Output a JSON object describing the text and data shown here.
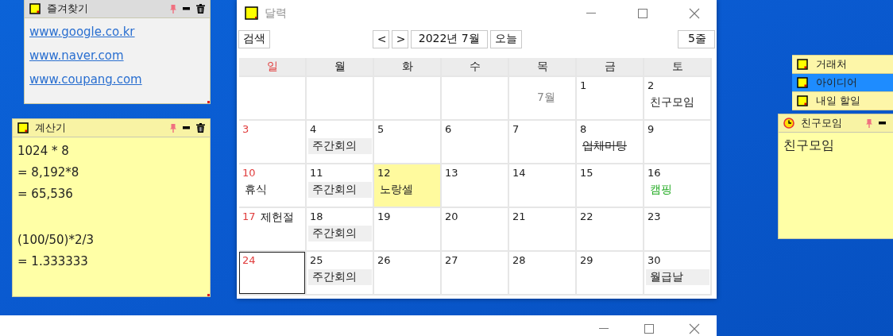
{
  "favorites_note": {
    "title": "즐겨찾기",
    "links": [
      "www.google.co.kr",
      "www.naver.com",
      "www.coupang.com"
    ]
  },
  "calculator_note": {
    "title": "계산기",
    "paragraphs": [
      [
        "1024 * 8",
        "= 8,192*8",
        "= 65,536"
      ],
      [
        "(100/50)*2/3",
        "= 1.333333"
      ]
    ]
  },
  "calendar": {
    "title": "달력",
    "toolbar": {
      "search": "검색",
      "prev": "<",
      "next": ">",
      "month": "2022년 7월",
      "today": "오늘",
      "rows": "5줄"
    },
    "weekdays": [
      {
        "label": "일",
        "kind": "sunday"
      },
      {
        "label": "월",
        "kind": "weekday"
      },
      {
        "label": "화",
        "kind": "weekday"
      },
      {
        "label": "수",
        "kind": "weekday"
      },
      {
        "label": "목",
        "kind": "weekday"
      },
      {
        "label": "금",
        "kind": "weekday"
      },
      {
        "label": "토",
        "kind": "weekday"
      }
    ],
    "weeks": [
      [
        {
          "selected": false,
          "highlighted": false
        },
        {
          "selected": false,
          "highlighted": false
        },
        {
          "selected": false,
          "highlighted": false
        },
        {
          "selected": false,
          "highlighted": false
        },
        {
          "month_label": "7월",
          "selected": false,
          "highlighted": false
        },
        {
          "day": "1",
          "selected": false,
          "highlighted": false
        },
        {
          "day": "2",
          "selected": false,
          "highlighted": false,
          "events": [
            {
              "text": "친구모임",
              "kind": "plain",
              "done": false,
              "color": "#202020"
            }
          ]
        }
      ],
      [
        {
          "day": "3",
          "selected": false,
          "highlighted": false
        },
        {
          "day": "4",
          "selected": false,
          "highlighted": false,
          "events": [
            {
              "text": "주간회의",
              "kind": "boxed",
              "done": false,
              "color": "#202020"
            }
          ]
        },
        {
          "day": "5",
          "selected": false,
          "highlighted": false
        },
        {
          "day": "6",
          "selected": false,
          "highlighted": false
        },
        {
          "day": "7",
          "selected": false,
          "highlighted": false
        },
        {
          "day": "8",
          "selected": false,
          "highlighted": false,
          "events": [
            {
              "text": "업체미팅",
              "kind": "plain",
              "done": true,
              "color": "#202020"
            }
          ]
        },
        {
          "day": "9",
          "selected": false,
          "highlighted": false
        }
      ],
      [
        {
          "day": "10",
          "selected": false,
          "highlighted": false,
          "events": [
            {
              "text": "휴식",
              "kind": "plain",
              "done": false,
              "color": "#202020"
            }
          ]
        },
        {
          "day": "11",
          "selected": false,
          "highlighted": false,
          "events": [
            {
              "text": "주간회의",
              "kind": "boxed",
              "done": false,
              "color": "#202020"
            }
          ]
        },
        {
          "day": "12",
          "selected": false,
          "highlighted": true,
          "events": [
            {
              "text": "노랑셀",
              "kind": "plain",
              "done": false,
              "color": "#202020"
            }
          ]
        },
        {
          "day": "13",
          "selected": false,
          "highlighted": false
        },
        {
          "day": "14",
          "selected": false,
          "highlighted": false
        },
        {
          "day": "15",
          "selected": false,
          "highlighted": false
        },
        {
          "day": "16",
          "selected": false,
          "highlighted": false,
          "events": [
            {
              "text": "캠핑",
              "kind": "plain",
              "done": false,
              "color": "#1faa1f"
            }
          ]
        }
      ],
      [
        {
          "day": "17",
          "selected": false,
          "highlighted": false,
          "events": [
            {
              "text": "제헌절",
              "kind": "inline",
              "done": false,
              "color": "#202020"
            }
          ]
        },
        {
          "day": "18",
          "selected": false,
          "highlighted": false,
          "events": [
            {
              "text": "주간회의",
              "kind": "boxed",
              "done": false,
              "color": "#202020"
            }
          ]
        },
        {
          "day": "19",
          "selected": false,
          "highlighted": false
        },
        {
          "day": "20",
          "selected": false,
          "highlighted": false
        },
        {
          "day": "21",
          "selected": false,
          "highlighted": false
        },
        {
          "day": "22",
          "selected": false,
          "highlighted": false
        },
        {
          "day": "23",
          "selected": false,
          "highlighted": false
        }
      ],
      [
        {
          "day": "24",
          "selected": true,
          "highlighted": false
        },
        {
          "day": "25",
          "selected": false,
          "highlighted": false,
          "events": [
            {
              "text": "주간회의",
              "kind": "boxed",
              "done": false,
              "color": "#202020"
            }
          ]
        },
        {
          "day": "26",
          "selected": false,
          "highlighted": false
        },
        {
          "day": "27",
          "selected": false,
          "highlighted": false
        },
        {
          "day": "28",
          "selected": false,
          "highlighted": false
        },
        {
          "day": "29",
          "selected": false,
          "highlighted": false
        },
        {
          "day": "30",
          "selected": false,
          "highlighted": false,
          "events": [
            {
              "text": "월급날",
              "kind": "boxed",
              "done": false,
              "color": "#202020"
            }
          ]
        }
      ]
    ]
  },
  "note_list": [
    {
      "title": "거래처",
      "selected": false
    },
    {
      "title": "아이디어",
      "selected": true
    },
    {
      "title": "내일 할일",
      "selected": false
    }
  ],
  "friends_note": {
    "title": "친구모임",
    "body": "친구모임"
  }
}
